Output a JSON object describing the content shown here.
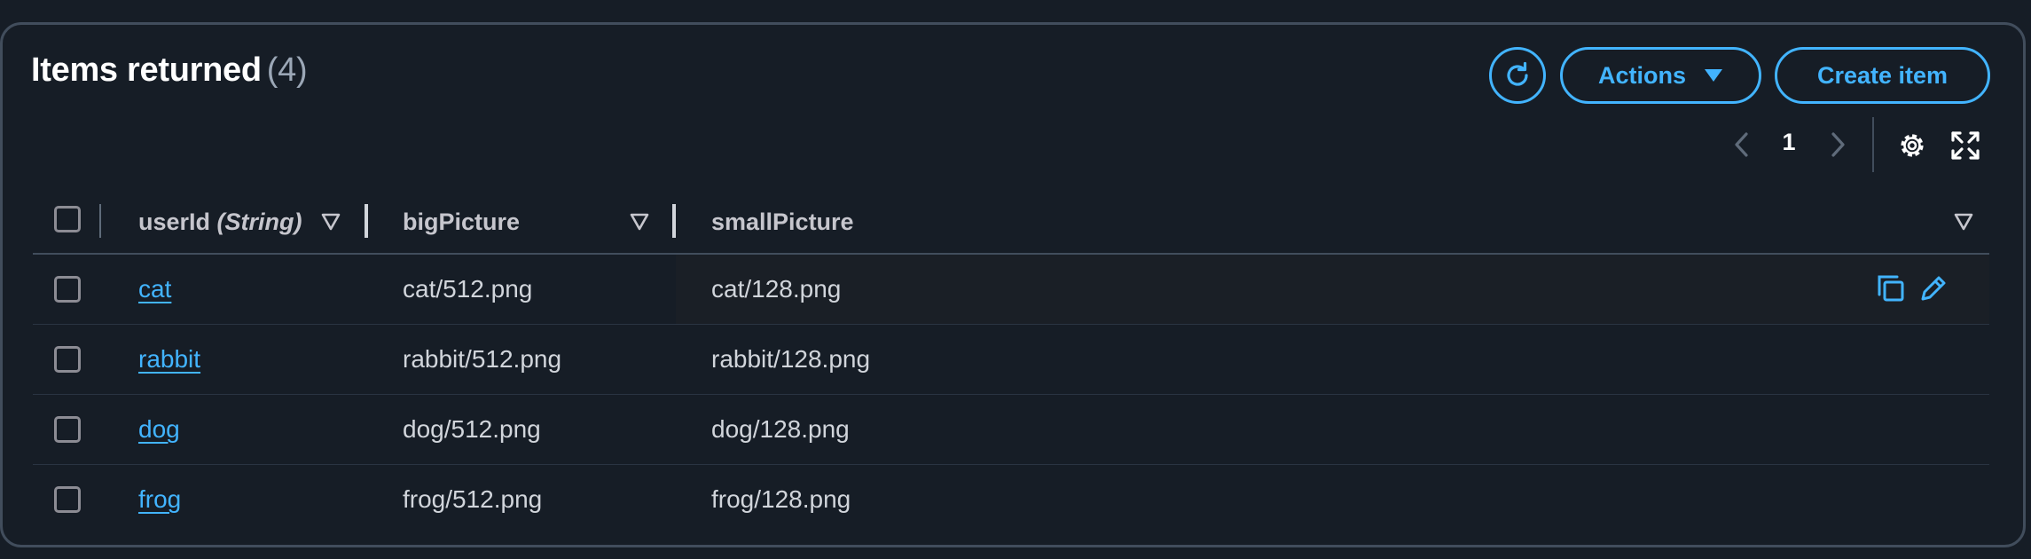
{
  "header": {
    "title": "Items returned",
    "count": "(4)"
  },
  "toolbar": {
    "refresh_icon": "refresh-icon",
    "actions_label": "Actions",
    "create_label": "Create item"
  },
  "pagination": {
    "current_page": "1"
  },
  "table": {
    "columns": [
      {
        "name": "userId",
        "type": "(String)"
      },
      {
        "name": "bigPicture"
      },
      {
        "name": "smallPicture"
      }
    ],
    "rows": [
      {
        "userId": "cat",
        "bigPicture": "cat/512.png",
        "smallPicture": "cat/128.png"
      },
      {
        "userId": "rabbit",
        "bigPicture": "rabbit/512.png",
        "smallPicture": "rabbit/128.png"
      },
      {
        "userId": "dog",
        "bigPicture": "dog/512.png",
        "smallPicture": "dog/128.png"
      },
      {
        "userId": "frog",
        "bigPicture": "frog/512.png",
        "smallPicture": "frog/128.png"
      }
    ]
  },
  "colors": {
    "background": "#161d26",
    "accent": "#42b4ff",
    "border": "#414d5c"
  }
}
